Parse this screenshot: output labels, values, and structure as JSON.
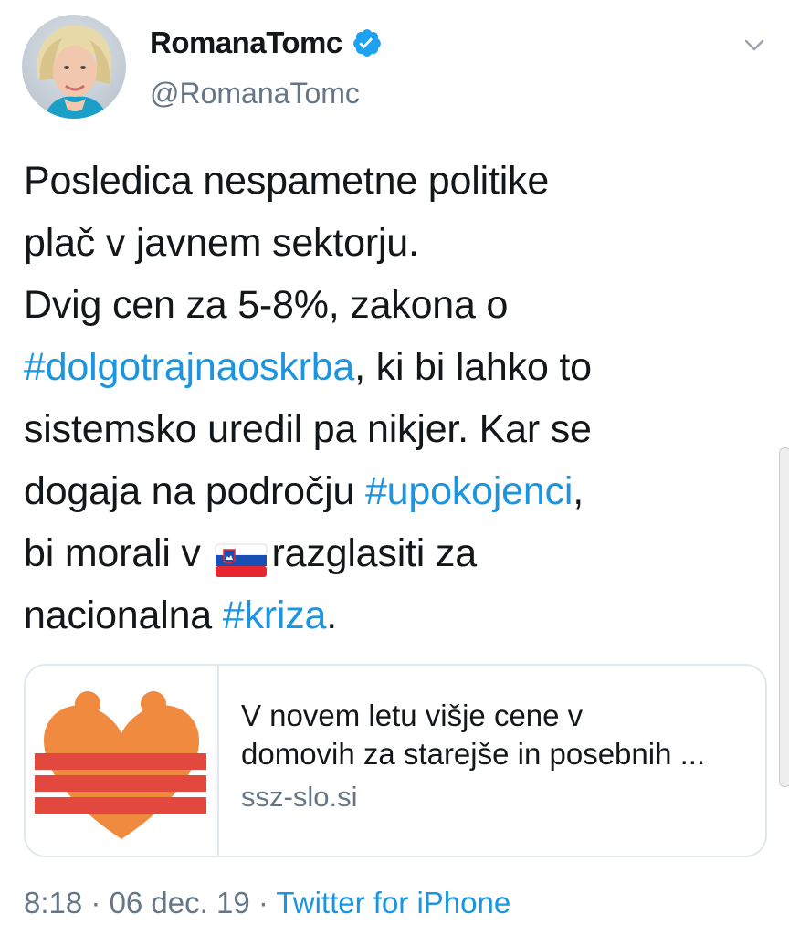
{
  "tweet": {
    "author": {
      "display_name": "RomanaTomc",
      "handle": "@RomanaTomc",
      "verified": true
    },
    "text": {
      "line1": "Posledica nespametne politike",
      "line2": "plač v javnem sektorju.",
      "line3": "Dvig cen za 5-8%, zakona o",
      "line4_hashtag": "#dolgotrajnaoskrba",
      "line4_rest": ", ki bi lahko to",
      "line5": "sistemsko uredil pa nikjer. Kar se",
      "line6_start": "dogaja na področju ",
      "line6_hashtag": "#upokojenci",
      "line6_end": ",",
      "line7_start": "bi morali v ",
      "line7_flag": "slovenia-flag-emoji",
      "line7_end": "razglasiti za",
      "line8_start": "nacionalna ",
      "line8_hashtag": "#kriza",
      "line8_end": "."
    },
    "link_card": {
      "title_line1": "V novem letu višje cene v",
      "title_line2": "domovih za starejše in posebnih ...",
      "domain": "ssz-slo.si",
      "image_icon": "heart-logo-icon"
    },
    "meta": {
      "time": "8:18",
      "sep1": " · ",
      "date": "06 dec. 19",
      "sep2": " · ",
      "source": "Twitter for iPhone"
    }
  },
  "colors": {
    "hashtag": "#1b95e0",
    "secondary_text": "#657786",
    "verified": "#1da1f2",
    "logo_orange": "#f08a3e",
    "logo_red": "#e2483e"
  }
}
